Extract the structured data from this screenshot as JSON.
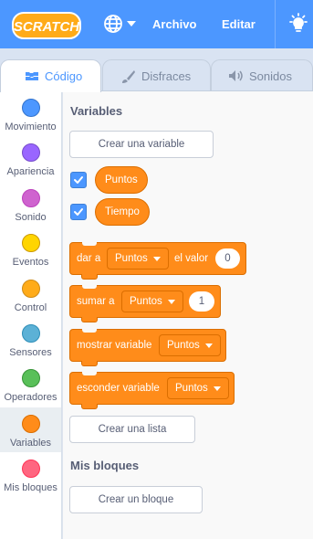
{
  "menubar": {
    "logo_text": "SCRATCH",
    "file_label": "Archivo",
    "edit_label": "Editar"
  },
  "tabs": [
    {
      "label": "Código",
      "active": true
    },
    {
      "label": "Disfraces",
      "active": false
    },
    {
      "label": "Sonidos",
      "active": false
    }
  ],
  "categories": [
    {
      "label": "Movimiento",
      "color": "#4c97ff"
    },
    {
      "label": "Apariencia",
      "color": "#9966ff"
    },
    {
      "label": "Sonido",
      "color": "#cf63cf"
    },
    {
      "label": "Eventos",
      "color": "#ffd500"
    },
    {
      "label": "Control",
      "color": "#ffab19"
    },
    {
      "label": "Sensores",
      "color": "#5cb1d6"
    },
    {
      "label": "Operadores",
      "color": "#59c059"
    },
    {
      "label": "Variables",
      "color": "#ff8c1a",
      "active": true
    },
    {
      "label": "Mis bloques",
      "color": "#ff6680"
    }
  ],
  "flyout": {
    "variables_title": "Variables",
    "create_variable": "Crear una variable",
    "reporters": [
      {
        "label": "Puntos",
        "checked": true
      },
      {
        "label": "Tiempo",
        "checked": true
      }
    ],
    "set_block": {
      "prefix": "dar a",
      "variable": "Puntos",
      "mid": "el valor",
      "value": "0"
    },
    "change_block": {
      "prefix": "sumar a",
      "variable": "Puntos",
      "value": "1"
    },
    "show_block": {
      "prefix": "mostrar variable",
      "variable": "Puntos"
    },
    "hide_block": {
      "prefix": "esconder variable",
      "variable": "Puntos"
    },
    "create_list": "Crear una lista",
    "my_blocks_title": "Mis bloques",
    "create_block": "Crear un bloque"
  },
  "colors": {
    "menubar": "#4c97ff",
    "variables": "#ff8c1a",
    "text": "#575e75"
  }
}
